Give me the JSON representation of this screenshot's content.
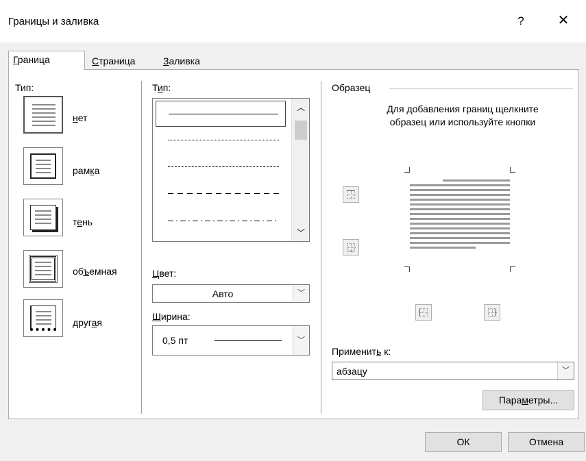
{
  "window": {
    "title": "Границы и заливка",
    "help": "?",
    "close": "✕"
  },
  "tabs": [
    {
      "pre": "",
      "key": "Г",
      "post": "раница"
    },
    {
      "pre": "",
      "key": "С",
      "post": "траница"
    },
    {
      "pre": "",
      "key": "З",
      "post": "аливка"
    }
  ],
  "setting": {
    "label": "Тип:",
    "items": [
      {
        "pre": "",
        "key": "н",
        "post": "ет"
      },
      {
        "pre": "рам",
        "key": "к",
        "post": "а"
      },
      {
        "pre": "т",
        "key": "е",
        "post": "нь"
      },
      {
        "pre": "об",
        "key": "ъ",
        "post": "емная"
      },
      {
        "pre": "друг",
        "key": "а",
        "post": "я"
      }
    ]
  },
  "style": {
    "label_pre": "Т",
    "label_key": "и",
    "label_post": "п:",
    "color_label_key": "Ц",
    "color_label_post": "вет:",
    "color_value": "Авто",
    "width_label_key": "Ш",
    "width_label_post": "ирина:",
    "width_value": "0,5 пт"
  },
  "preview": {
    "label": "Образец",
    "hint": "Для добавления границ щелкните образец или используйте кнопки",
    "apply_label_pre": "Применит",
    "apply_label_key": "ь",
    "apply_label_post": " к:",
    "apply_value": "абзацу",
    "options_pre": "Пара",
    "options_key": "м",
    "options_post": "етры..."
  },
  "footer": {
    "ok": "ОК",
    "cancel": "Отмена"
  }
}
